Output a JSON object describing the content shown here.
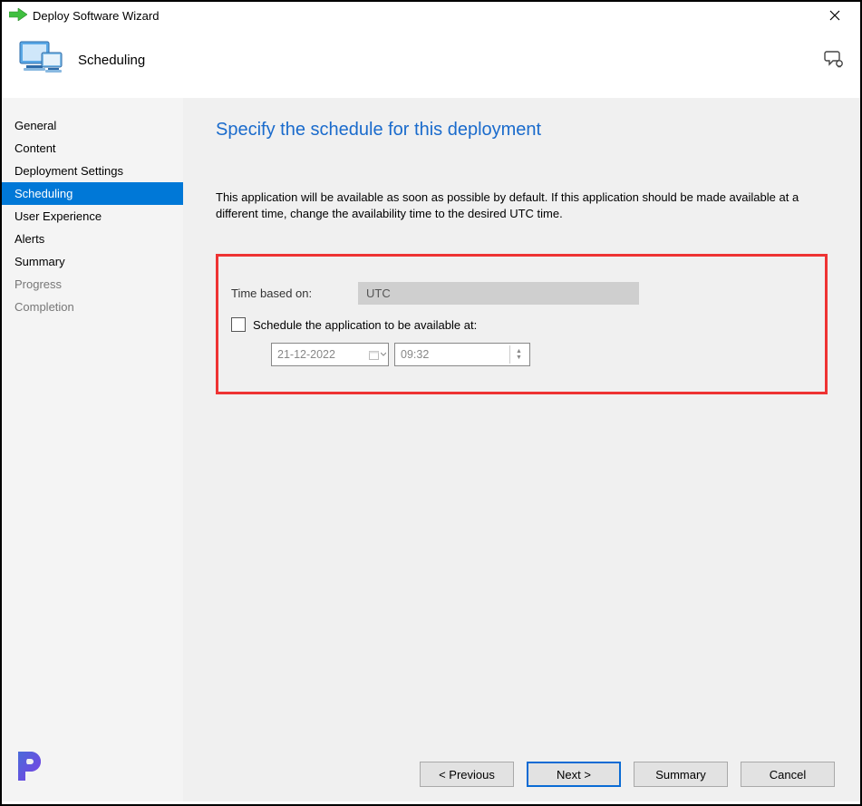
{
  "window": {
    "title": "Deploy Software Wizard"
  },
  "header": {
    "page_name": "Scheduling"
  },
  "sidebar": {
    "items": [
      {
        "label": "General",
        "active": false,
        "muted": false
      },
      {
        "label": "Content",
        "active": false,
        "muted": false
      },
      {
        "label": "Deployment Settings",
        "active": false,
        "muted": false
      },
      {
        "label": "Scheduling",
        "active": true,
        "muted": false
      },
      {
        "label": "User Experience",
        "active": false,
        "muted": false
      },
      {
        "label": "Alerts",
        "active": false,
        "muted": false
      },
      {
        "label": "Summary",
        "active": false,
        "muted": false
      },
      {
        "label": "Progress",
        "active": false,
        "muted": true
      },
      {
        "label": "Completion",
        "active": false,
        "muted": true
      }
    ]
  },
  "main": {
    "heading": "Specify the schedule for this deployment",
    "description": "This application will be available as soon as possible by default. If this application should be made available at a different time, change the availability time to the desired UTC time.",
    "time_based_label": "Time based on:",
    "time_based_value": "UTC",
    "schedule_checkbox_label": "Schedule the application to be available at:",
    "date_value": "21-12-2022",
    "time_value": "09:32"
  },
  "buttons": {
    "previous": "< Previous",
    "next": "Next >",
    "summary": "Summary",
    "cancel": "Cancel"
  }
}
